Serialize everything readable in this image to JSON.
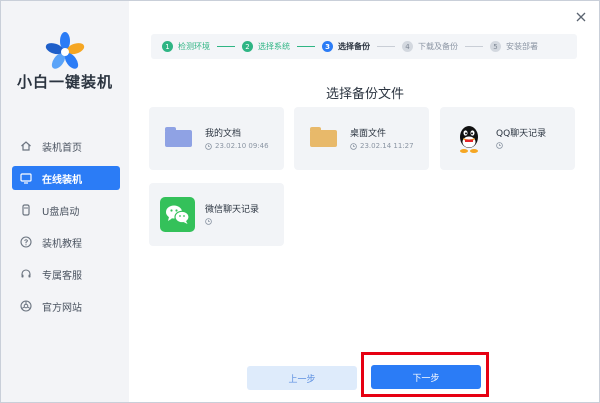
{
  "app": {
    "title": "装机首页",
    "brand": "小白一键装机"
  },
  "sidebar": {
    "items": [
      {
        "label": "装机首页",
        "icon": "home-icon"
      },
      {
        "label": "在线装机",
        "icon": "monitor-icon",
        "active": true
      },
      {
        "label": "U盘启动",
        "icon": "usb-icon"
      },
      {
        "label": "装机教程",
        "icon": "help-icon"
      },
      {
        "label": "专属客服",
        "icon": "headset-icon"
      },
      {
        "label": "官方网站",
        "icon": "browser-icon"
      }
    ]
  },
  "steps": [
    {
      "num": "1",
      "label": "检测环境",
      "state": "done"
    },
    {
      "num": "2",
      "label": "选择系统",
      "state": "done"
    },
    {
      "num": "3",
      "label": "选择备份",
      "state": "current"
    },
    {
      "num": "4",
      "label": "下载及备份",
      "state": "todo"
    },
    {
      "num": "5",
      "label": "安装部署",
      "state": "todo"
    }
  ],
  "section_title": "选择备份文件",
  "backups": [
    {
      "name": "我的文档",
      "time": "23.02.10 09:46",
      "icon": "folder-icon",
      "color": "#8fa2e4"
    },
    {
      "name": "桌面文件",
      "time": "23.02.14 11:27",
      "icon": "folder-icon",
      "color": "#e8b96a"
    },
    {
      "name": "QQ聊天记录",
      "time": "",
      "icon": "qq-icon",
      "color": "#000000"
    },
    {
      "name": "微信聊天记录",
      "time": "",
      "icon": "wechat-icon",
      "color": "#34c15a"
    }
  ],
  "buttons": {
    "prev": "上一步",
    "next": "下一步"
  },
  "colors": {
    "accent": "#2b7cf6",
    "success": "#2fb584",
    "highlight": "#e60012"
  }
}
